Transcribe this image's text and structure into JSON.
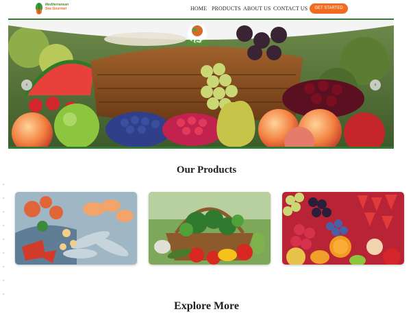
{
  "brand": {
    "name_line1": "Mediterranean",
    "name_line2": "Sea Gourmet",
    "hero_badge": "MSG"
  },
  "nav": {
    "items": [
      {
        "label": "HOME"
      },
      {
        "label": "PRODUCTS"
      },
      {
        "label": "ABOUT US"
      },
      {
        "label": "CONTACT US"
      }
    ],
    "cta_label": "GET STARTED"
  },
  "hero": {
    "prev_icon": "chevron-left-icon",
    "next_icon": "chevron-right-icon",
    "prev_glyph": "‹",
    "next_glyph": "›"
  },
  "products": {
    "title": "Our Products",
    "cards": [
      {
        "image": "seafood-platter"
      },
      {
        "image": "vegetable-basket"
      },
      {
        "image": "mixed-fruits-berries"
      }
    ]
  },
  "explore": {
    "title": "Explore More"
  },
  "colors": {
    "accent_orange": "#f26b1f",
    "brand_green": "#2e7d32"
  }
}
